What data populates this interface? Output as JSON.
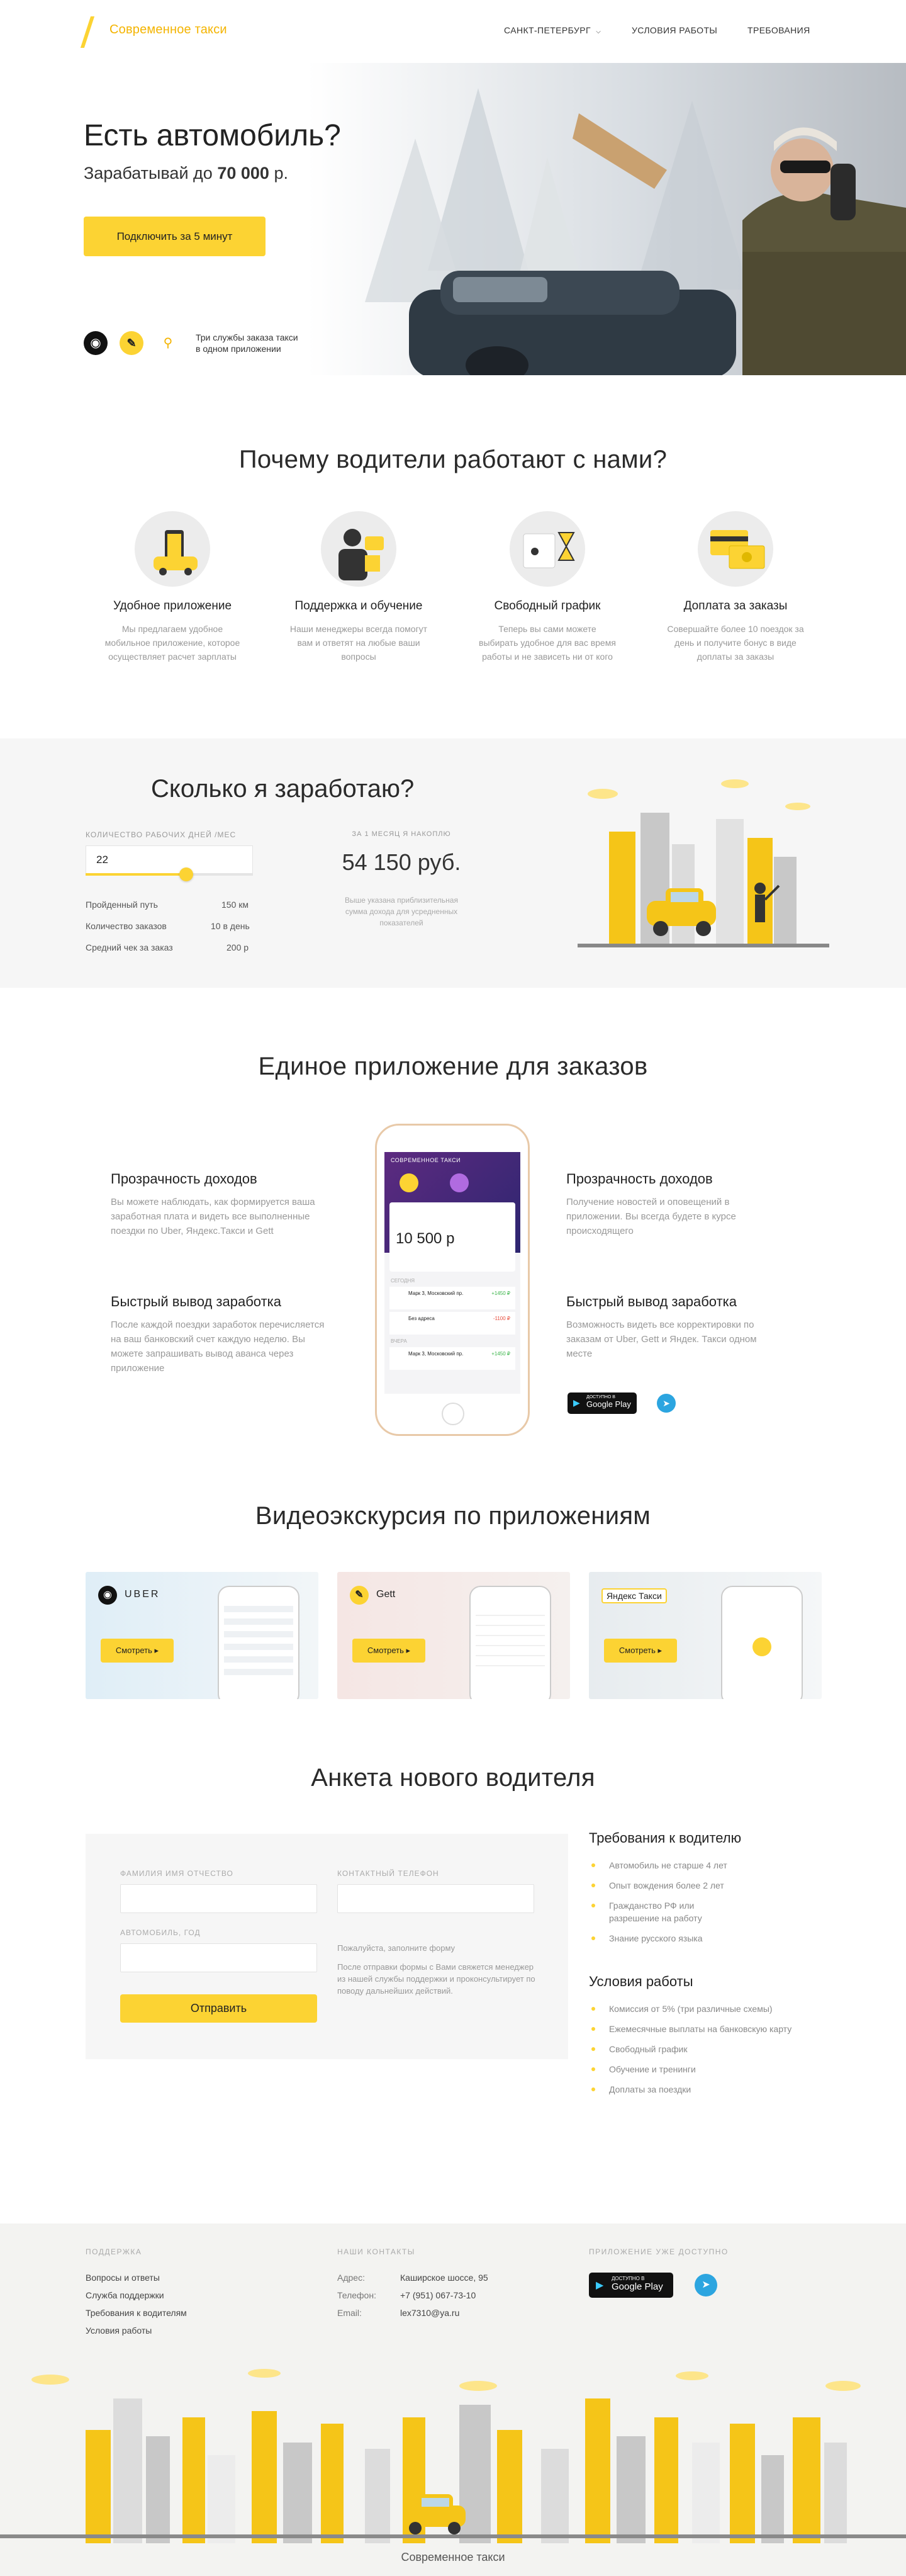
{
  "header": {
    "logo": "Современное такси",
    "nav": {
      "city": "САНКТ-ПЕТЕРБУРГ",
      "conditions": "УСЛОВИЯ РАБОТЫ",
      "requirements": "ТРЕБОВАНИЯ"
    }
  },
  "hero": {
    "title": "Есть автомобиль?",
    "subtitle_prefix": "Зарабатывай до",
    "subtitle_amount": "70 000",
    "subtitle_suffix": "р.",
    "cta": "Подключить за 5 минут",
    "services_note_1": "Три службы заказа такси",
    "services_note_2": "в одном приложении"
  },
  "why": {
    "title": "Почему водители работают с нами?",
    "items": [
      {
        "title": "Удобное приложение",
        "text": "Мы предлагаем удобное мобильное приложение, которое осуществляет расчет зарплаты"
      },
      {
        "title": "Поддержка и обучение",
        "text": "Наши менеджеры всегда помогут вам и ответят на любые ваши вопросы"
      },
      {
        "title": "Свободный график",
        "text": "Теперь вы сами можете выбирать удобное для вас время работы и не зависеть ни от кого"
      },
      {
        "title": "Доплата за заказы",
        "text": "Совершайте более 10 поездок за день и получите бонус в виде доплаты за заказы"
      }
    ]
  },
  "earn": {
    "title": "Сколько я заработаю?",
    "days_label": "КОЛИЧЕСТВО РАБОЧИХ ДНЕЙ /МЕС",
    "days_value": "22",
    "slider_level": 0.6,
    "rows": [
      {
        "k": "Пройденный путь",
        "v": "150 км"
      },
      {
        "k": "Количество заказов",
        "v": "10 в день"
      },
      {
        "k": "Средний чек за заказ",
        "v": "200 р"
      }
    ],
    "result_label": "ЗА 1 МЕСЯЦ Я НАКОПЛЮ",
    "result": "54 150 руб.",
    "note": "Выше указана приблизительная сумма дохода для усредненных показателей"
  },
  "app": {
    "title": "Единое приложение для заказов",
    "left": [
      {
        "title": "Прозрачность доходов",
        "text": "Вы можете наблюдать, как формируется ваша заработная плата и видеть все выполненные поездки по Uber, Яндекс.Такси и Gett"
      },
      {
        "title": "Быстрый вывод заработка",
        "text": "После каждой поездки заработок перечисляется на ваш банковский счет каждую неделю. Вы можете запрашивать вывод аванса через приложение"
      }
    ],
    "right": [
      {
        "title": "Прозрачность доходов",
        "text": "Получение новостей и оповещений в приложении. Вы всегда будете в курсе происходящего"
      },
      {
        "title": "Быстрый вывод заработка",
        "text": "Возможность видеть все корректировки по заказам от Uber, Gett и Яндек. Такси одном месте"
      }
    ],
    "phone": {
      "header": "СОВРЕМЕННОЕ ТАКСИ",
      "balance": "10 500 р",
      "today": "СЕГОДНЯ",
      "t1": "Марк 3, Московский пр.",
      "a1": "+1450 ₽",
      "t2": "Без адреса",
      "a2": "-1100 ₽",
      "t3": "Марк 3, Московский пр.",
      "a3": "+1450 ₽",
      "yesterday": "ВЧЕРА"
    },
    "google_play": "Google Play",
    "gp_small": "ДОСТУПНО В"
  },
  "video": {
    "title": "Видеоэкскурсия по приложениям",
    "cards": [
      {
        "brand": "UBER",
        "btn": "Смотреть"
      },
      {
        "brand": "Gett",
        "btn": "Смотреть"
      },
      {
        "brand": "Яндекс Такси",
        "btn": "Смотреть"
      }
    ]
  },
  "form": {
    "title": "Анкета нового водителя",
    "name_label": "ФАМИЛИЯ ИМЯ ОТЧЕСТВО",
    "phone_label": "КОНТАКТНЫЙ ТЕЛЕФОН",
    "car_label": "АВТОМОБИЛЬ, ГОД",
    "hint": "Пожалуйста, заполните форму",
    "note": "После отправки формы с Вами свяжется менеджер из нашей службы поддержки и проконсультирует по поводу дальнейших действий.",
    "submit": "Отправить"
  },
  "requirements": {
    "title": "Требования к водителю",
    "items": [
      "Автомобиль не старше 4 лет",
      "Опыт вождения более 2 лет",
      "Гражданство РФ или разрешение на работу",
      "Знание русского языка"
    ]
  },
  "conditions": {
    "title": "Условия работы",
    "items": [
      "Комиссия от 5% (три различные схемы)",
      "Ежемесячные выплаты на банковскую карту",
      "Свободный график",
      "Обучение и тренинги",
      "Доплаты за поездки"
    ]
  },
  "footer": {
    "support_title": "ПОДДЕРЖКА",
    "support_links": [
      "Вопросы и ответы",
      "Служба поддержки",
      "Требования к водителям",
      "Условия работы"
    ],
    "contacts_title": "НАШИ КОНТАКТЫ",
    "contacts": [
      {
        "k": "Адрес:",
        "v": "Каширское шоссе, 95"
      },
      {
        "k": "Телефон:",
        "v": "+7 (951) 067-73-10"
      },
      {
        "k": "Email:",
        "v": "lex7310@ya.ru"
      }
    ],
    "app_title": "ПРИЛОЖЕНИЕ УЖЕ ДОСТУПНО",
    "copyright": "Современное такси"
  }
}
